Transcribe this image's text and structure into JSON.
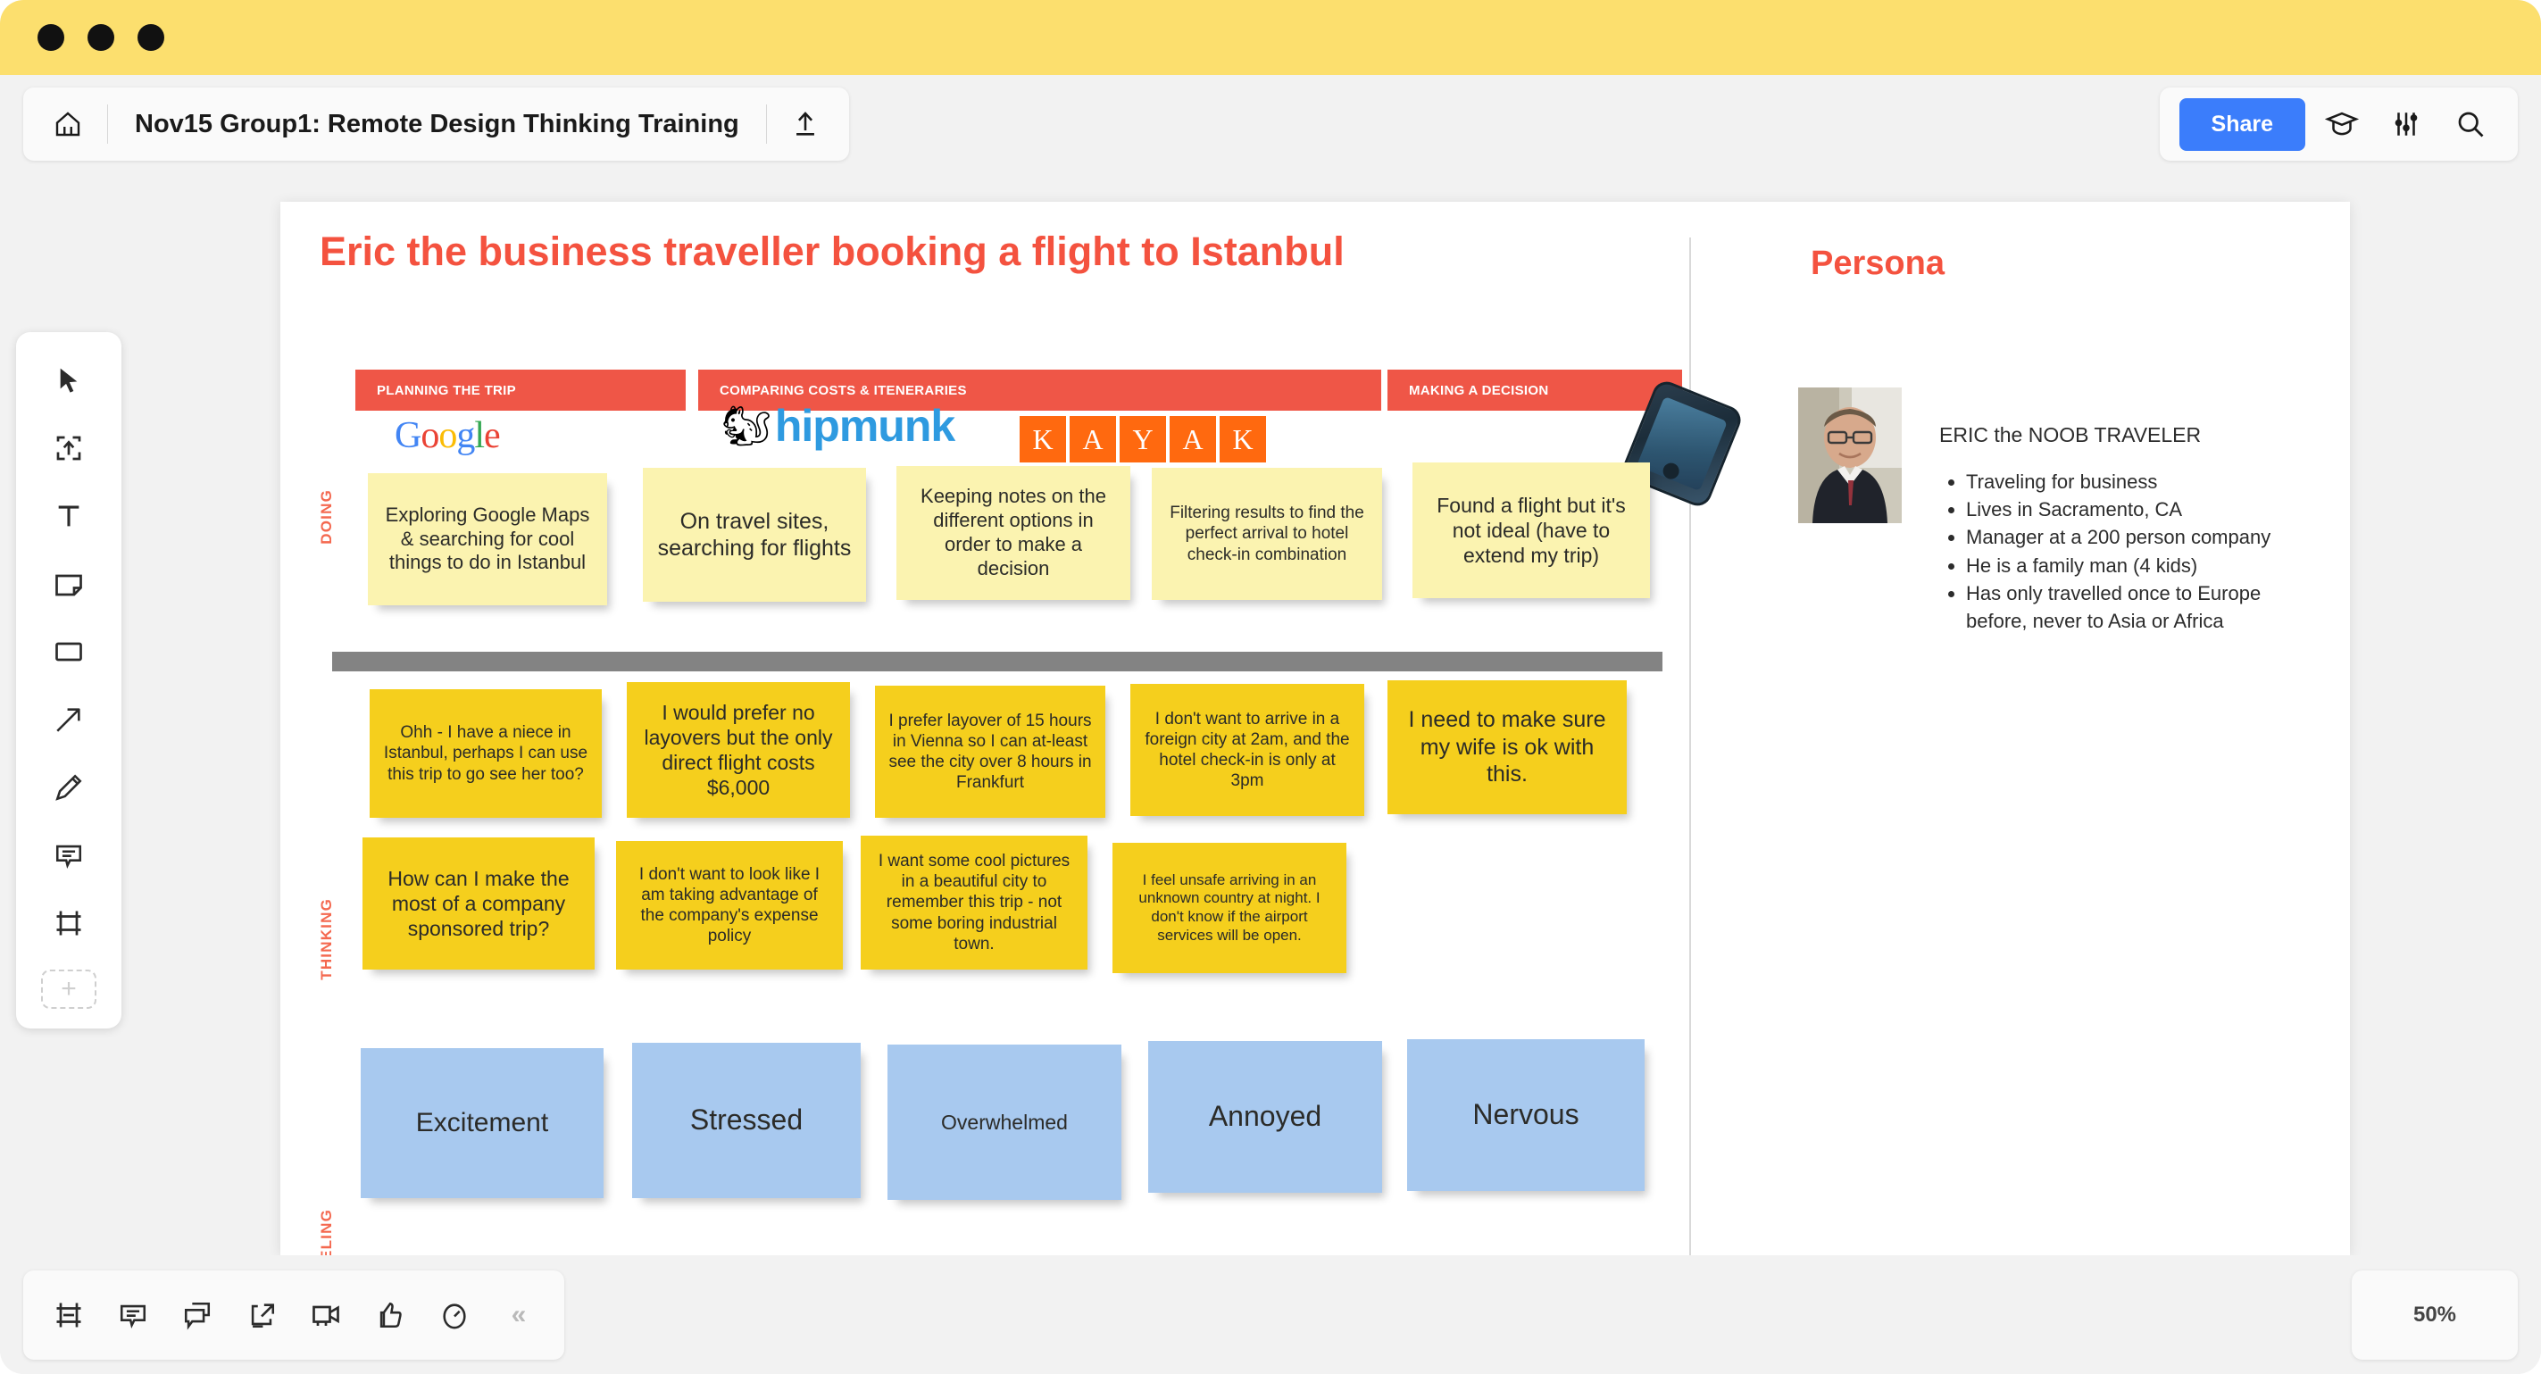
{
  "window": {
    "dots": 3
  },
  "header": {
    "home_icon": "home-icon",
    "board_title": "Nov15 Group1: Remote Design Thinking Training",
    "upload_icon": "upload-icon",
    "share_label": "Share",
    "graduation_icon": "graduation-cap-icon",
    "settings_icon": "sliders-icon",
    "search_icon": "search-icon"
  },
  "toolbar": {
    "items": [
      {
        "name": "select-tool",
        "icon": "cursor-icon"
      },
      {
        "name": "upload-tool",
        "icon": "upload-box-icon"
      },
      {
        "name": "text-tool",
        "icon": "text-icon"
      },
      {
        "name": "sticky-tool",
        "icon": "sticky-note-icon"
      },
      {
        "name": "shape-tool",
        "icon": "rectangle-icon"
      },
      {
        "name": "arrow-tool",
        "icon": "arrow-icon"
      },
      {
        "name": "pen-tool",
        "icon": "pen-icon"
      },
      {
        "name": "comment-tool",
        "icon": "comment-icon"
      },
      {
        "name": "frame-tool",
        "icon": "frame-icon"
      }
    ],
    "add_label": "+"
  },
  "board": {
    "heading": "Eric the business traveller booking a flight to Istanbul",
    "phases": [
      {
        "label": "PLANNING THE TRIP"
      },
      {
        "label": "COMPARING COSTS & ITENERARIES"
      },
      {
        "label": "MAKING A DECISION"
      }
    ],
    "row_labels": {
      "doing": "DOING",
      "thinking": "THINKING",
      "feeling": "FEELING"
    },
    "logos": [
      {
        "name": "google-logo",
        "text": "Google"
      },
      {
        "name": "hipmunk-logo",
        "text": "hipmunk"
      },
      {
        "name": "kayak-logo",
        "letters": [
          "K",
          "A",
          "Y",
          "A",
          "K"
        ]
      },
      {
        "name": "phone-image",
        "text": ""
      }
    ],
    "doing_notes": [
      "Exploring Google Maps & searching for cool things to do in Istanbul",
      "On travel sites, searching for flights",
      "Keeping notes on the different options in order to make a decision",
      "Filtering results to find the perfect arrival to hotel check-in combination",
      "Found a flight but it's not ideal (have to extend my trip)"
    ],
    "thinking_notes_row1": [
      "Ohh - I have a niece in Istanbul, perhaps I can use this trip to go see her too?",
      "I would prefer no layovers but the only direct flight costs $6,000",
      "I prefer layover of 15 hours in Vienna so I can at-least see the city over 8 hours in Frankfurt",
      "I don't want to arrive in a foreign city at 2am, and the hotel check-in is only at 3pm",
      "I need to make sure my wife is ok with this."
    ],
    "thinking_notes_row2": [
      "How can I make the most of a company sponsored trip?",
      "I don't want to look like I am taking advantage of the company's expense policy",
      "I want some cool pictures in a beautiful city to remember this trip - not some boring industrial town.",
      "I feel unsafe arriving in an unknown country at night. I don't know if the airport services will be open."
    ],
    "feeling_notes": [
      "Excitement",
      "Stressed",
      "Overwhelmed",
      "Annoyed",
      "Nervous"
    ]
  },
  "persona": {
    "title": "Persona",
    "name": "ERIC the NOOB TRAVELER",
    "bullets": [
      "Traveling for business",
      "Lives in Sacramento, CA",
      "Manager at a 200 person company",
      "He is a family man (4 kids)",
      "Has only travelled once to Europe before, never to Asia or Africa"
    ]
  },
  "bottombar": {
    "items": [
      {
        "name": "frames-panel-button",
        "icon": "frames-icon"
      },
      {
        "name": "comments-button",
        "icon": "comment-icon"
      },
      {
        "name": "chat-button",
        "icon": "chat-icon"
      },
      {
        "name": "export-button",
        "icon": "export-icon"
      },
      {
        "name": "video-chat-button",
        "icon": "video-icon"
      },
      {
        "name": "reactions-button",
        "icon": "thumbs-up-icon"
      },
      {
        "name": "timer-button",
        "icon": "timer-icon"
      }
    ],
    "collapse_label": "«",
    "zoom_level": "50%"
  },
  "colors": {
    "titlebar": "#fcdf6e",
    "accent_red": "#f4523f",
    "phase_bar": "#ef5647",
    "share_blue": "#3b7dfb",
    "note_doing": "#fbf3b0",
    "note_thinking": "#f5cf1d",
    "note_feeling": "#a8c9ef",
    "divider_gray": "#838383"
  }
}
